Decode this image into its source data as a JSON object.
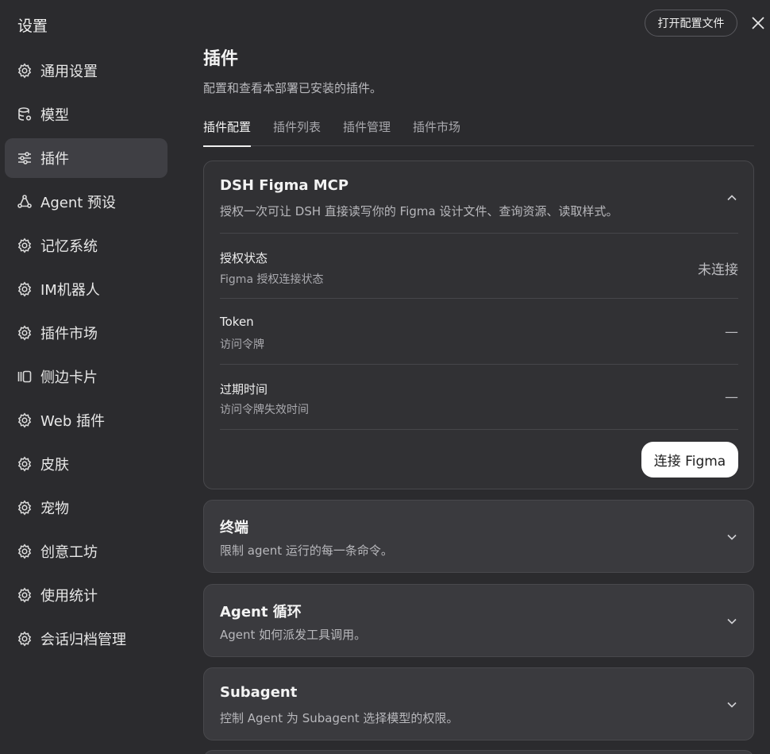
{
  "sidebar": {
    "title": "设置",
    "items": [
      {
        "label": "通用设置",
        "icon": "gear-icon",
        "active": false
      },
      {
        "label": "模型",
        "icon": "database-gear-icon",
        "active": false
      },
      {
        "label": "插件",
        "icon": "sliders-icon",
        "active": true
      },
      {
        "label": "Agent 预设",
        "icon": "agent-icon",
        "active": false
      },
      {
        "label": "记忆系统",
        "icon": "gear-icon",
        "active": false
      },
      {
        "label": "IM机器人",
        "icon": "gear-icon",
        "active": false
      },
      {
        "label": "插件市场",
        "icon": "gear-icon",
        "active": false
      },
      {
        "label": "侧边卡片",
        "icon": "side-panel-icon",
        "active": false
      },
      {
        "label": "Web 插件",
        "icon": "gear-icon",
        "active": false
      },
      {
        "label": "皮肤",
        "icon": "gear-icon",
        "active": false
      },
      {
        "label": "宠物",
        "icon": "gear-icon",
        "active": false
      },
      {
        "label": "创意工坊",
        "icon": "gear-icon",
        "active": false
      },
      {
        "label": "使用统计",
        "icon": "gear-icon",
        "active": false
      },
      {
        "label": "会话归档管理",
        "icon": "gear-icon",
        "active": false
      }
    ]
  },
  "header": {
    "open_config_label": "打开配置文件"
  },
  "main": {
    "title": "插件",
    "description": "配置和查看本部署已安装的插件。",
    "tabs": [
      {
        "label": "插件配置",
        "active": true
      },
      {
        "label": "插件列表",
        "active": false
      },
      {
        "label": "插件管理",
        "active": false
      },
      {
        "label": "插件市场",
        "active": false
      }
    ],
    "cards": [
      {
        "title": "DSH Figma MCP",
        "description": "授权一次可让 DSH 直接读写你的 Figma 设计文件、查询资源、读取样式。",
        "expanded": true,
        "rows": [
          {
            "label": "授权状态",
            "sub": "Figma 授权连接状态",
            "value": "未连接"
          },
          {
            "label": "Token",
            "sub": "访问令牌",
            "value": "—"
          },
          {
            "label": "过期时间",
            "sub": "访问令牌失效时间",
            "value": "—"
          }
        ],
        "action_label": "连接 Figma"
      },
      {
        "title": "终端",
        "description": "限制 agent 运行的每一条命令。",
        "expanded": false
      },
      {
        "title": "Agent 循环",
        "description": "Agent 如何派发工具调用。",
        "expanded": false
      },
      {
        "title": "Subagent",
        "description": "控制 Agent 为 Subagent 选择模型的权限。",
        "expanded": false
      }
    ]
  },
  "colors": {
    "background": "#2b2b2e",
    "active_nav": "#3f3f44",
    "card": "#313134",
    "button_primary": "#ffffff"
  }
}
